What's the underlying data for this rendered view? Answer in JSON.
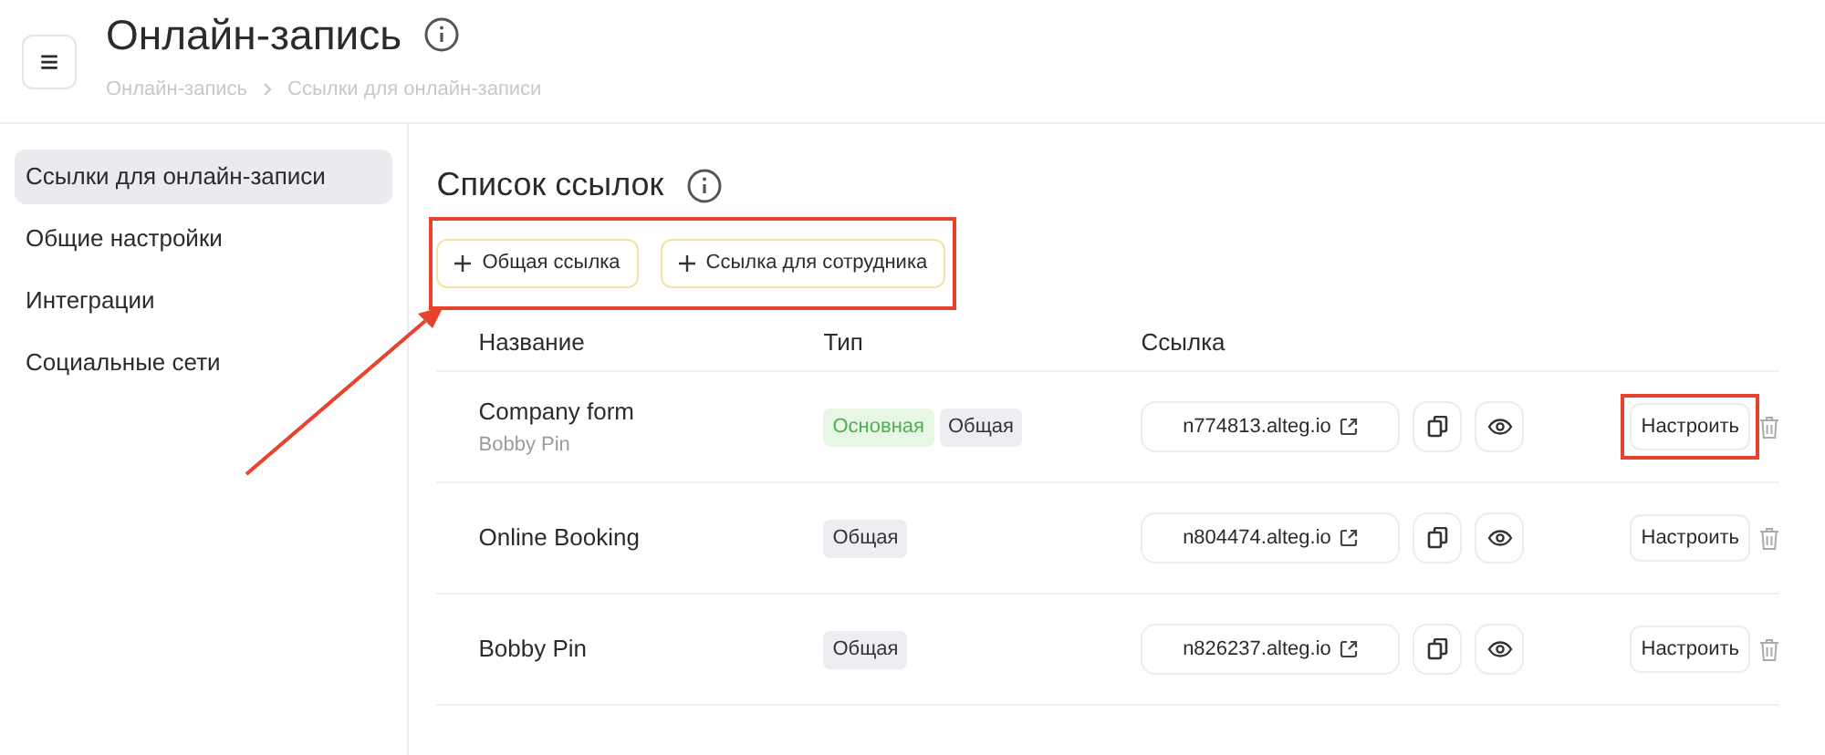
{
  "header": {
    "menu_button": "≡",
    "title": "Онлайн-запись",
    "breadcrumbs": [
      "Онлайн-запись",
      "Ссылки для онлайн-записи"
    ]
  },
  "sidebar": {
    "items": [
      {
        "label": "Ссылки для онлайн-записи",
        "selected": true
      },
      {
        "label": "Общие настройки",
        "selected": false
      },
      {
        "label": "Интеграции",
        "selected": false
      },
      {
        "label": "Социальные сети",
        "selected": false
      }
    ]
  },
  "section": {
    "title": "Список ссылок",
    "create_buttons": [
      "Общая ссылка",
      "Ссылка для сотрудника"
    ],
    "create_buttons_highlighted": true
  },
  "table": {
    "columns": [
      "Название",
      "Тип",
      "Ссылка"
    ],
    "rows": [
      {
        "name": "Company form",
        "subtitle": "Bobby Pin",
        "tags": [
          {
            "kind": "primary",
            "label": "Основная"
          },
          {
            "kind": "general",
            "label": "Общая"
          }
        ],
        "link": "n774813.alteg.io",
        "configure": "Настроить",
        "configure_highlighted": true
      },
      {
        "name": "Online Booking",
        "tags": [
          {
            "kind": "general",
            "label": "Общая"
          }
        ],
        "link": "n804474.alteg.io",
        "configure": "Настроить",
        "configure_highlighted": false
      },
      {
        "name": "Bobby Pin",
        "tags": [
          {
            "kind": "general",
            "label": "Общая"
          }
        ],
        "link": "n826237.alteg.io",
        "configure": "Настроить",
        "configure_highlighted": false
      }
    ]
  }
}
